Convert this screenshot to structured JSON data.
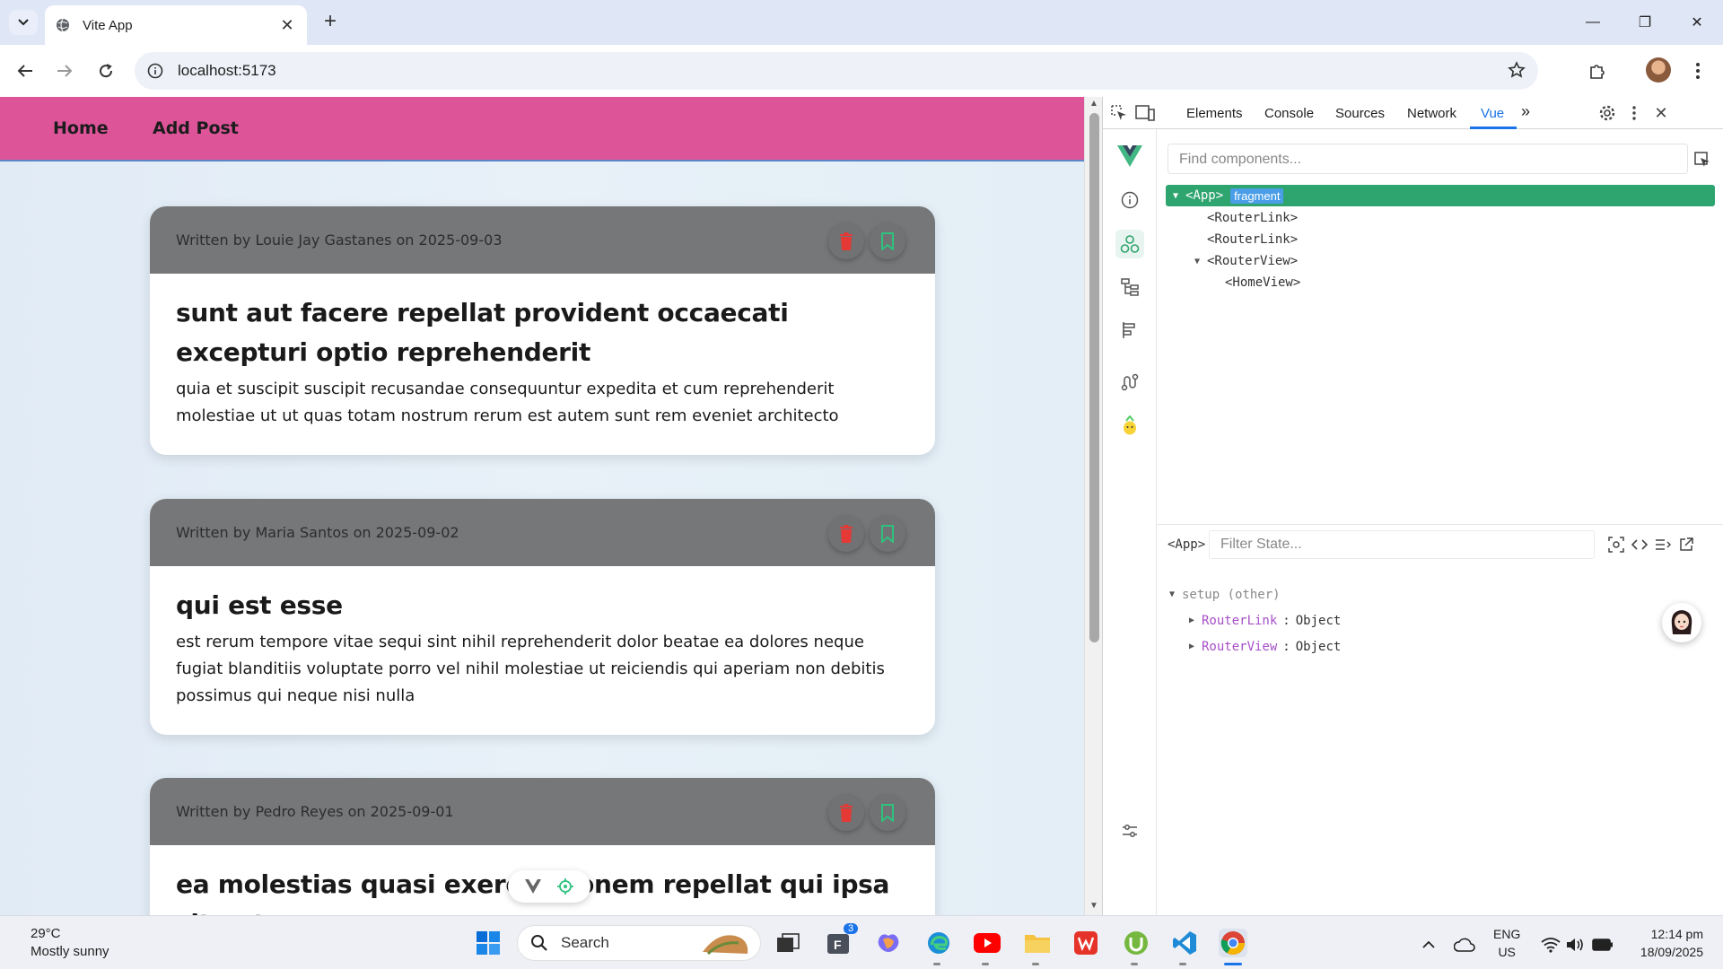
{
  "browser": {
    "tab_title": "Vite App",
    "url": "localhost:5173"
  },
  "app_nav": {
    "home": "Home",
    "add_post": "Add Post"
  },
  "posts": [
    {
      "meta": "Written by Louie Jay Gastanes on 2025-09-03",
      "title": "sunt aut facere repellat provident occaecati excepturi optio reprehenderit",
      "body": "quia et suscipit suscipit recusandae consequuntur expedita et cum reprehenderit molestiae ut ut quas totam nostrum rerum est autem sunt rem eveniet architecto"
    },
    {
      "meta": "Written by Maria Santos on 2025-09-02",
      "title": "qui est esse",
      "body": "est rerum tempore vitae sequi sint nihil reprehenderit dolor beatae ea dolores neque fugiat blanditiis voluptate porro vel nihil molestiae ut reiciendis qui aperiam non debitis possimus qui neque nisi nulla"
    },
    {
      "meta": "Written by Pedro Reyes on 2025-09-01",
      "title": "ea molestias quasi exercitationem repellat qui ipsa sit aut",
      "body": ""
    }
  ],
  "devtools": {
    "tabs": [
      "Elements",
      "Console",
      "Sources",
      "Network",
      "Vue"
    ],
    "active_tab": "Vue",
    "find_placeholder": "Find components...",
    "tree": {
      "app": "<App>",
      "fragment": "fragment",
      "router_link_1": "<RouterLink>",
      "router_link_2": "<RouterLink>",
      "router_view": "<RouterView>",
      "home_view": "<HomeView>"
    },
    "state_tag": "<App>",
    "filter_placeholder": "Filter State...",
    "setup_label": "setup (other)",
    "state_rows": [
      {
        "key": "RouterLink",
        "value": "Object"
      },
      {
        "key": "RouterView",
        "value": "Object"
      }
    ]
  },
  "taskbar": {
    "temp": "29°C",
    "weather": "Mostly sunny",
    "search": "Search",
    "lang": "ENG",
    "region": "US",
    "time": "12:14 pm",
    "date": "18/09/2025",
    "badge": "3"
  },
  "colors": {
    "nav_pink": "#dd5499",
    "card_head": "#757779",
    "vue_green": "#2ea46e",
    "delete_red": "#e53935",
    "bookmark_green": "#2ec27e"
  }
}
